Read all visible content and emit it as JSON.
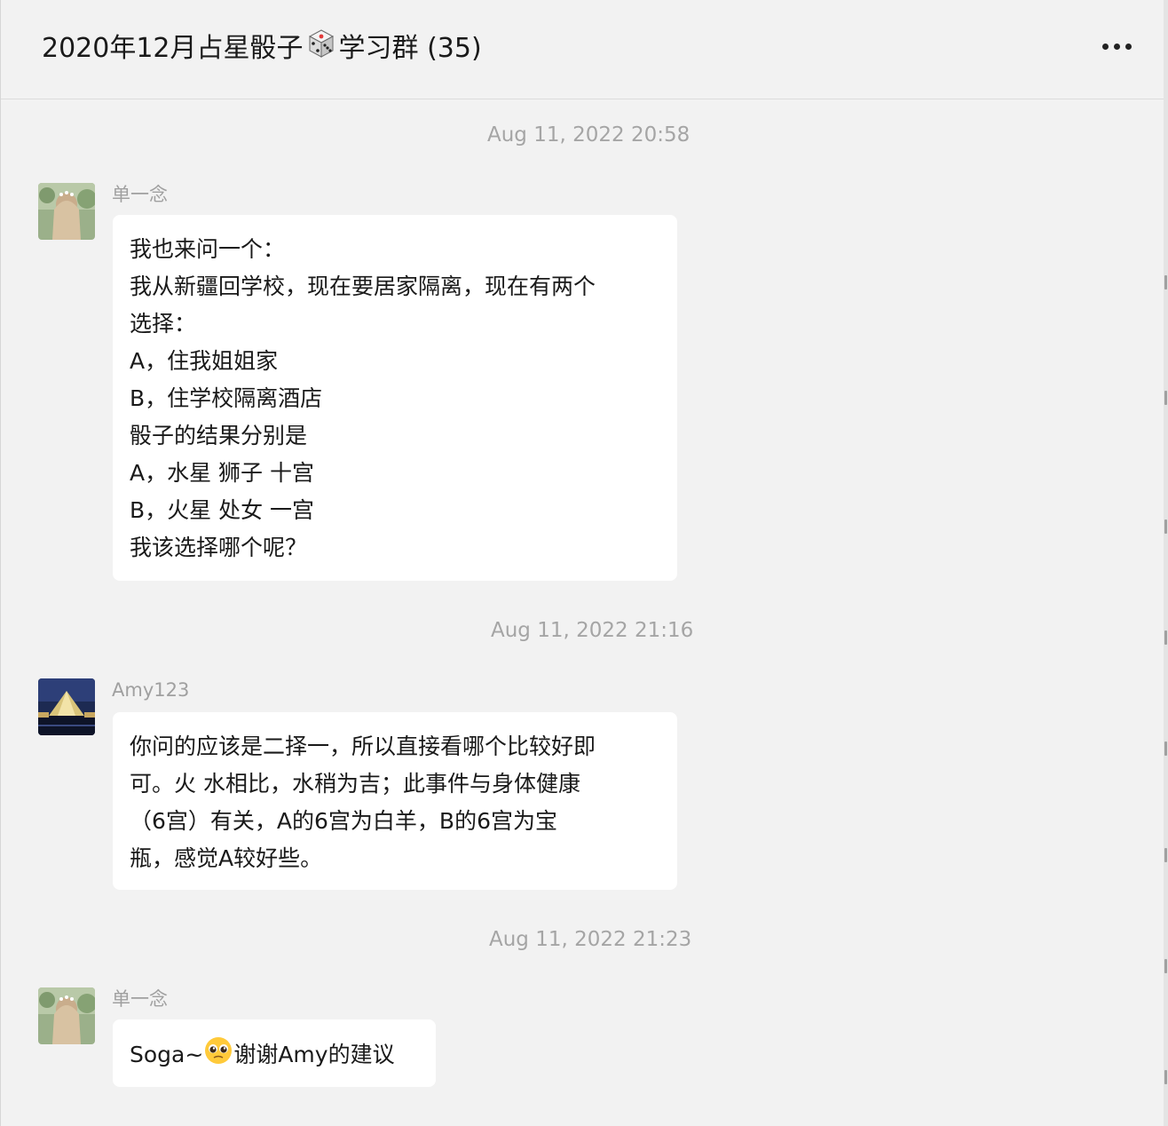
{
  "header": {
    "title_part1": "2020年12月占星骰子",
    "title_icon": "dice-emoji",
    "title_part2": "学习群 (35)",
    "more_icon": "more-horizontal-icon"
  },
  "messages": [
    {
      "timestamp": "Aug 11, 2022 20:58",
      "sender": "单一念",
      "avatar": "girl-avatar",
      "lines": [
        "我也来问一个：",
        "我从新疆回学校，现在要居家隔离，现在有两个",
        "选择：",
        "A，住我姐姐家",
        "B，住学校隔离酒店",
        "骰子的结果分别是",
        "A，水星 狮子 十宫",
        "B，火星 处女 一宫",
        "我该选择哪个呢？"
      ]
    },
    {
      "timestamp": "Aug 11, 2022 21:16",
      "sender": "Amy123",
      "avatar": "louvre-avatar",
      "lines": [
        "你问的应该是二择一，所以直接看哪个比较好即",
        "可。火 水相比，水稍为吉；此事件与身体健康",
        "（6宫）有关，A的6宫为白羊，B的6宫为宝",
        "瓶，感觉A较好些。"
      ]
    },
    {
      "timestamp": "Aug 11, 2022 21:23",
      "sender": "单一念",
      "avatar": "girl-avatar",
      "text_before_emoji": "Soga~",
      "emoji": "pleading-face-emoji",
      "text_after_emoji": "谢谢Amy的建议"
    }
  ]
}
